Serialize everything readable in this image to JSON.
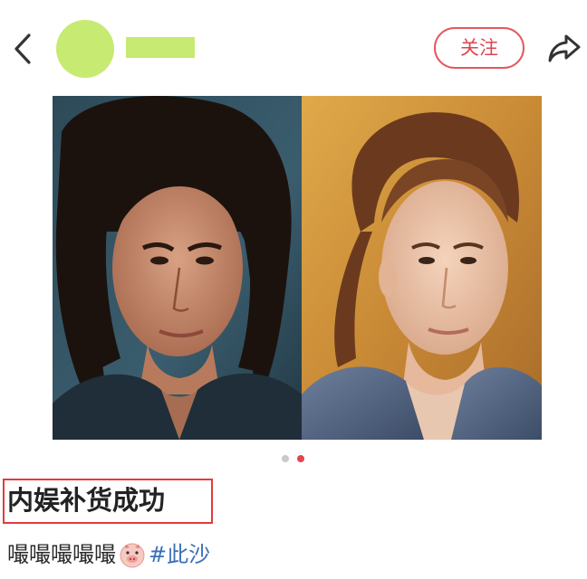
{
  "header": {
    "back_icon": "chevron-left-icon",
    "username": "",
    "follow_label": "关注",
    "share_icon": "share-arrow-icon",
    "avatar_color": "#c6ea72",
    "accent_color": "#e3575f"
  },
  "post": {
    "image_count": 2,
    "active_index": 2,
    "title": "内娱补货成功",
    "caption_text": "嘬嘬嘬嘬嘬",
    "emoji": "piglet-face-emoji",
    "hashtag": "#此沙",
    "hashtag_color": "#3b6fb5"
  }
}
